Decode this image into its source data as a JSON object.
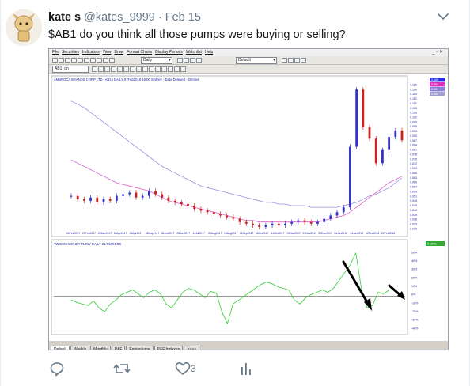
{
  "tweet": {
    "name": "kate s",
    "handle": "@kates_9999",
    "dot": "·",
    "date": "Feb 15",
    "text": "$AB1 do you think all those pumps were buying or selling?",
    "like_count": "3"
  },
  "app": {
    "menu": [
      "File",
      "Securities",
      "Indicators",
      "View",
      "Draw",
      "Format Charts",
      "Display Periods",
      "Watchlist",
      "Help"
    ],
    "win_controls": "_ ▫ ✕",
    "period_select": "Daily",
    "layout_select": "Default",
    "security_code": "AB1_dn",
    "tabs": [
      "Default",
      "Weekly",
      "Monthly",
      "P&F",
      "Equivolume",
      "P&F Indexes",
      ">>>>"
    ],
    "active_tab": 0
  },
  "colors": {
    "background": "#ffffff",
    "ui_gray": "#d4d0c8",
    "up_candle": "#3333cc",
    "down_candle": "#cc2222",
    "ma_purple": "#9b8ee0",
    "ma_pink": "#e060c8",
    "money_flow_green": "#33cc33",
    "arrow": "#000000"
  },
  "chart_data": [
    {
      "type": "line",
      "title": "AMBROCA BRANDS CORP LTD | AB1 | DAILY 07Feb2018 16:00 Sydney - Data Delayed - 20mins",
      "x_ticks": [
        "06Feb2017",
        "27Feb2017",
        "20Mar2017",
        "10Apr2017",
        "28Apr2017",
        "18May2017",
        "08Jun2017",
        "28Jun2017",
        "14Jul2017",
        "02Aug2017",
        "18Aug2017",
        "06Sep2017",
        "06Oct2017",
        "14Oct2017",
        "03Nov2017",
        "21Nov2017",
        "29Dec2017",
        "06Jan2018",
        "24Jan2018",
        "12Feb2018",
        "22Feb2018"
      ],
      "y_ticks": [
        "0.118",
        "0.116",
        "0.114",
        "0.112",
        "0.110",
        "0.108",
        "0.105",
        "0.102",
        "0.099",
        "0.096",
        "0.093",
        "0.090",
        "0.087",
        "0.084",
        "0.081",
        "0.078",
        "0.075",
        "0.072",
        "0.069",
        "0.066",
        "0.063",
        "0.060",
        "0.057",
        "0.054",
        "0.051",
        "0.048",
        "0.045",
        "0.042",
        "0.039",
        "0.036",
        "0.033",
        "0.030"
      ],
      "ylim": [
        0.03,
        0.118
      ],
      "price_labels": [
        "0.085",
        "0.084",
        "0.084",
        "0.083"
      ],
      "series": [
        {
          "kind": "price",
          "values": [
            0.05,
            0.048,
            0.047,
            0.049,
            0.046,
            0.048,
            0.047,
            0.05,
            0.051,
            0.052,
            0.049,
            0.05,
            0.053,
            0.051,
            0.049,
            0.047,
            0.046,
            0.045,
            0.044,
            0.042,
            0.041,
            0.04,
            0.039,
            0.038,
            0.037,
            0.036,
            0.034,
            0.033,
            0.032,
            0.031,
            0.032,
            0.033,
            0.032,
            0.033,
            0.034,
            0.035,
            0.034,
            0.033,
            0.034,
            0.036,
            0.038,
            0.04,
            0.043,
            0.08,
            0.115,
            0.092,
            0.085,
            0.07,
            0.078,
            0.086,
            0.09,
            0.084
          ]
        },
        {
          "kind": "ma_slow",
          "values": [
            0.108,
            0.106,
            0.104,
            0.101,
            0.098,
            0.095,
            0.092,
            0.089,
            0.086,
            0.083,
            0.08,
            0.077,
            0.074,
            0.071,
            0.068,
            0.066,
            0.064,
            0.062,
            0.06,
            0.058,
            0.056,
            0.055,
            0.054,
            0.053,
            0.052,
            0.051,
            0.05,
            0.049,
            0.048,
            0.047,
            0.046,
            0.046,
            0.045,
            0.045,
            0.044,
            0.044,
            0.044,
            0.043,
            0.043,
            0.043,
            0.043,
            0.043,
            0.044,
            0.045,
            0.046,
            0.048,
            0.05,
            0.051,
            0.053,
            0.055,
            0.058,
            0.061
          ]
        },
        {
          "kind": "ma_fast",
          "values": [
            0.072,
            0.07,
            0.068,
            0.066,
            0.064,
            0.062,
            0.06,
            0.058,
            0.057,
            0.056,
            0.055,
            0.054,
            0.053,
            0.051,
            0.049,
            0.047,
            0.046,
            0.045,
            0.044,
            0.043,
            0.042,
            0.041,
            0.04,
            0.039,
            0.038,
            0.037,
            0.036,
            0.035,
            0.035,
            0.034,
            0.034,
            0.034,
            0.034,
            0.034,
            0.034,
            0.034,
            0.034,
            0.034,
            0.034,
            0.035,
            0.036,
            0.037,
            0.038,
            0.04,
            0.043,
            0.046,
            0.049,
            0.052,
            0.055,
            0.058,
            0.06,
            0.062
          ]
        }
      ]
    },
    {
      "type": "line",
      "title": "TWIGGS MONEY FLOW DAILY 21 PERIODS",
      "y_ticks": [
        "50%",
        "40%",
        "30%",
        "20%",
        "10%",
        "0%",
        "-10%",
        "-20%",
        "-30%",
        "-40%"
      ],
      "ylim": [
        -45,
        60
      ],
      "values_label": "0.02%",
      "series": [
        {
          "name": "",
          "values": [
            -5,
            -8,
            -10,
            -12,
            -6,
            -15,
            -20,
            -10,
            -5,
            2,
            5,
            8,
            3,
            -2,
            5,
            8,
            3,
            -10,
            -15,
            -5,
            5,
            10,
            8,
            3,
            -2,
            6,
            4,
            -20,
            -35,
            -10,
            -5,
            0,
            5,
            10,
            15,
            18,
            16,
            12,
            10,
            8,
            -5,
            -10,
            -2,
            2,
            5,
            8,
            5,
            10,
            20,
            30,
            40,
            55,
            10,
            -15,
            -12,
            5,
            3,
            8
          ]
        }
      ]
    }
  ]
}
